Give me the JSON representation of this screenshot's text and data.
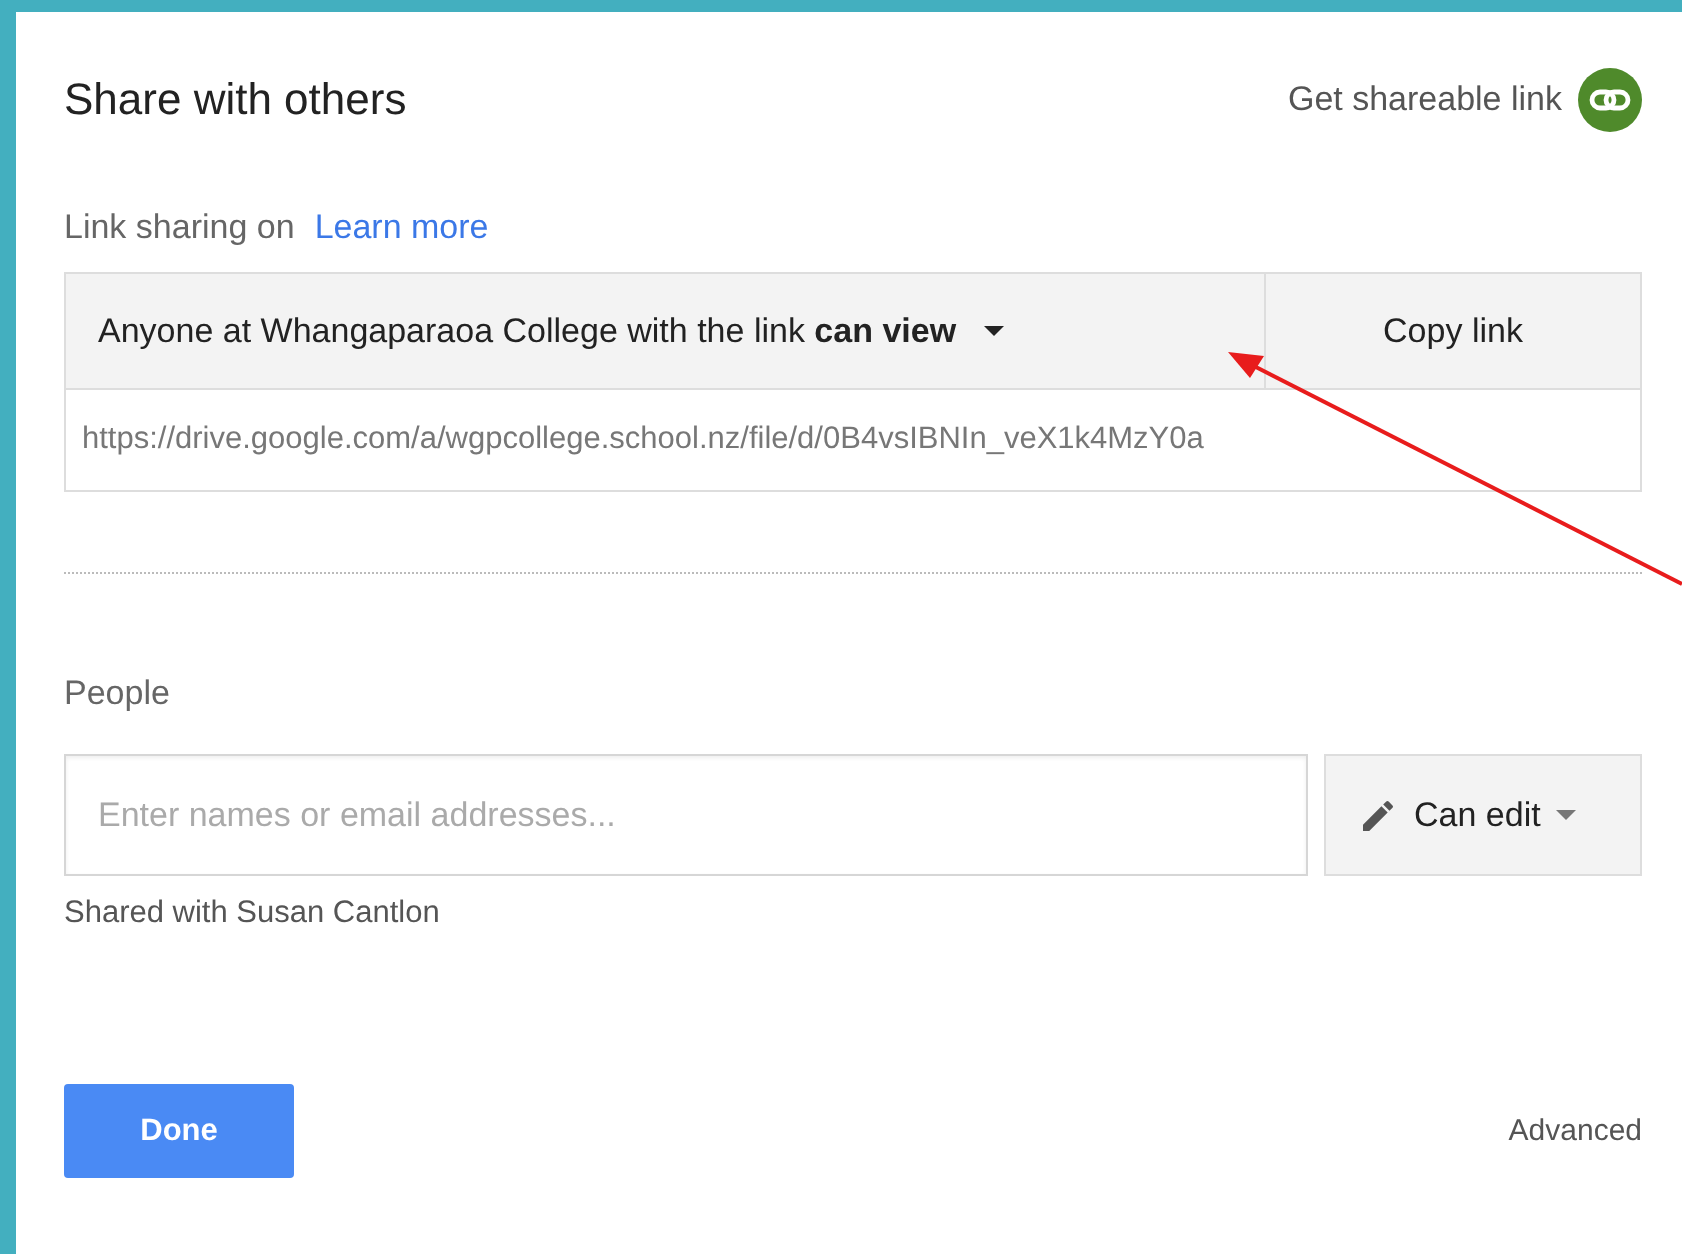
{
  "dialog": {
    "title": "Share with others",
    "shareable_link": "Get shareable link"
  },
  "link_sharing": {
    "status": "Link sharing on",
    "learn_more": "Learn more",
    "access": "Anyone at Whangaparaoa College with the link **can view**",
    "copy_button": "Copy link",
    "url": "https://drive.google.com/a/wgpcollege.school.nz/file/d/0B4vsIBNIn_veX1k4MzY0a"
  },
  "people": {
    "heading": "People",
    "placeholder": "Enter names or email addresses...",
    "permission": "Can edit",
    "shared_with": "Shared with Susan Cantlon"
  },
  "footer": {
    "done_button": "Done",
    "advanced_link": "Advanced"
  }
}
